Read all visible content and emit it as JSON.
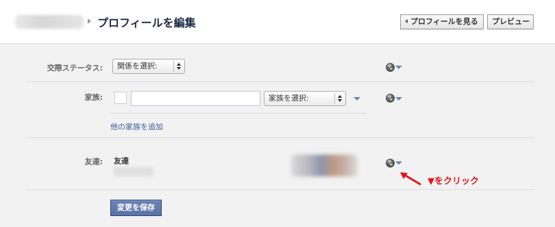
{
  "header": {
    "title": "プロフィールを編集",
    "view_profile_label": "プロフィールを見る",
    "preview_label": "プレビュー"
  },
  "relationship": {
    "label": "交際ステータス:",
    "select_value": "関係を選択:"
  },
  "family": {
    "label": "家族:",
    "name_value": "",
    "select_value": "家族を選択:",
    "add_link": "他の家族を追加"
  },
  "friends": {
    "label": "友達:",
    "title": "友達"
  },
  "annotation": {
    "text": "▼をクリック",
    "color": "#e4141b"
  },
  "save_label": "変更を保存",
  "colors": {
    "accent": "#3b5998",
    "save_button": "#5b74a8",
    "panel_bg": "#f2f2f2"
  }
}
